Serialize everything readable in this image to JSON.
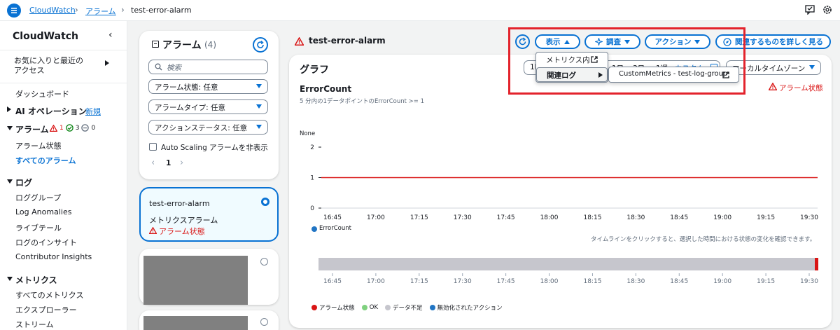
{
  "breadcrumb": {
    "root": "CloudWatch",
    "section": "アラーム",
    "current": "test-error-alarm"
  },
  "sidebar": {
    "title": "CloudWatch",
    "favorites": "お気に入りと最近の\nアクセス",
    "dashboard": "ダッシュボード",
    "ai_ops": "AI オペレーション",
    "new_badge": "新規",
    "alarms": "アラーム",
    "alarm_counts": {
      "alarm": "1",
      "ok": "3",
      "insufficient": "0"
    },
    "alarm_state": "アラーム状態",
    "all_alarms": "すべてのアラーム",
    "logs": "ログ",
    "log_items": [
      "ロググループ",
      "Log Anomalies",
      "ライブテール",
      "ログのインサイト",
      "Contributor Insights"
    ],
    "metrics": "メトリクス",
    "metric_items": [
      "すべてのメトリクス",
      "エクスプローラー",
      "ストリーム"
    ]
  },
  "alarm_list": {
    "title": "アラーム",
    "count": "(4)",
    "search_placeholder": "検索",
    "filters": [
      "アラーム状態: 任意",
      "アラームタイプ: 任意",
      "アクションステータス: 任意"
    ],
    "autoscaling_label": "Auto Scaling アラームを非表示",
    "page": "1",
    "selected_item": {
      "name": "test-error-alarm",
      "type": "メトリクスアラーム",
      "state": "アラーム状態"
    }
  },
  "detail": {
    "title": "test-error-alarm",
    "buttons": {
      "view": "表示",
      "investigate": "調査",
      "actions": "アクション",
      "learn": "関連するものを詳しく見る"
    },
    "dropdown": {
      "metrics_in": "メトリクス内",
      "related_logs": "関連ログ",
      "log_group": "CustomMetrics - test-log-group"
    },
    "graph": {
      "header": "グラフ",
      "range_partial": "1h",
      "range_1d": "1日",
      "range_3d": "3日",
      "range_1w": "1週",
      "custom": "カスタム",
      "timezone": "ローカルタイムゾーン",
      "metric_name": "ErrorCount",
      "state_label": "アラーム状態",
      "subtitle": "5 分内の1データポイントのErrorCount >= 1",
      "unit_label": "None",
      "timeline_hint": "タイムラインをクリックすると、選択した時間における状態の変化を確認できます。",
      "legend_series": "ErrorCount",
      "timeline_legend": [
        "アラーム状態",
        "OK",
        "データ不足",
        "無効化されたアクション"
      ]
    }
  },
  "colors": {
    "accent": "#0972d3",
    "alarm": "#d91515",
    "ok": "#7fd17f",
    "insufficient": "#c6c6cd",
    "disabled": "#2175c4",
    "highlight": "#e3232c"
  },
  "chart_data": {
    "type": "line",
    "title": "ErrorCount",
    "ylabel": "None",
    "x": [
      "16:45",
      "17:00",
      "17:15",
      "17:30",
      "17:45",
      "18:00",
      "18:15",
      "18:30",
      "18:45",
      "19:00",
      "19:15",
      "19:30"
    ],
    "yticks": [
      "0",
      "1",
      "2"
    ],
    "ylim": [
      0,
      2
    ],
    "threshold": 1,
    "series": [
      {
        "name": "ErrorCount",
        "values": []
      }
    ]
  }
}
